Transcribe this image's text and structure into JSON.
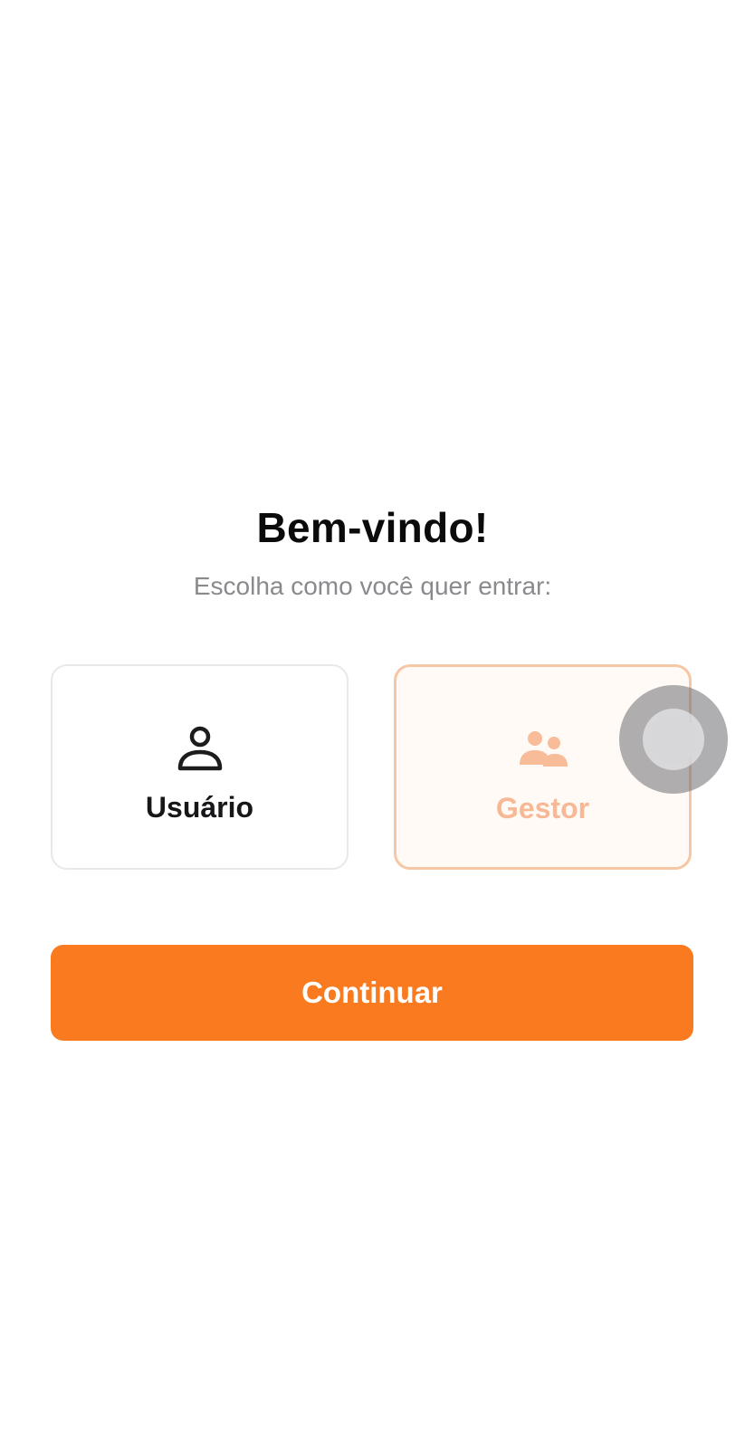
{
  "header": {
    "title": "Bem-vindo!",
    "subtitle": "Escolha como você quer entrar:"
  },
  "options": [
    {
      "label": "Usuário",
      "icon": "person-icon",
      "selected": false
    },
    {
      "label": "Gestor",
      "icon": "people-group-icon",
      "selected": true
    }
  ],
  "continue_button": {
    "label": "Continuar"
  },
  "colors": {
    "accent": "#f97a1f",
    "selected_border": "#f6c7a4",
    "selected_text": "#f7b995",
    "title_text": "#0b0b0b",
    "subtitle_text": "#8a8a8e"
  }
}
